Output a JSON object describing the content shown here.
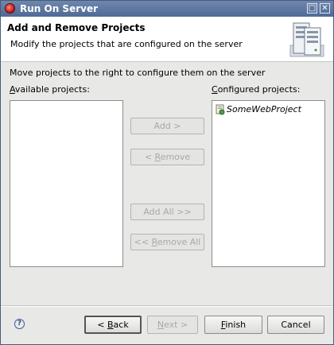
{
  "window": {
    "title": "Run On Server"
  },
  "header": {
    "title": "Add and Remove Projects",
    "description": "Modify the projects that are configured on the server"
  },
  "instruction": "Move projects to the right to configure them on the server",
  "available": {
    "label_mnemonic": "A",
    "label_rest": "vailable projects:",
    "items": []
  },
  "configured": {
    "label_mnemonic": "C",
    "label_rest": "onfigured projects:",
    "items": [
      {
        "label": "SomeWebProject"
      }
    ]
  },
  "buttons": {
    "add": "Add >",
    "remove_pre": "< ",
    "remove_mn": "R",
    "remove_post": "emove",
    "add_all": "Add All >>",
    "remove_all_pre": "<< ",
    "remove_all_mn": "R",
    "remove_all_post": "emove All",
    "back_pre": "< ",
    "back_mn": "B",
    "back_post": "ack",
    "next_mn": "N",
    "next_post": "ext >",
    "finish_mn": "F",
    "finish_post": "inish",
    "cancel": "Cancel"
  },
  "help_icon": "?"
}
